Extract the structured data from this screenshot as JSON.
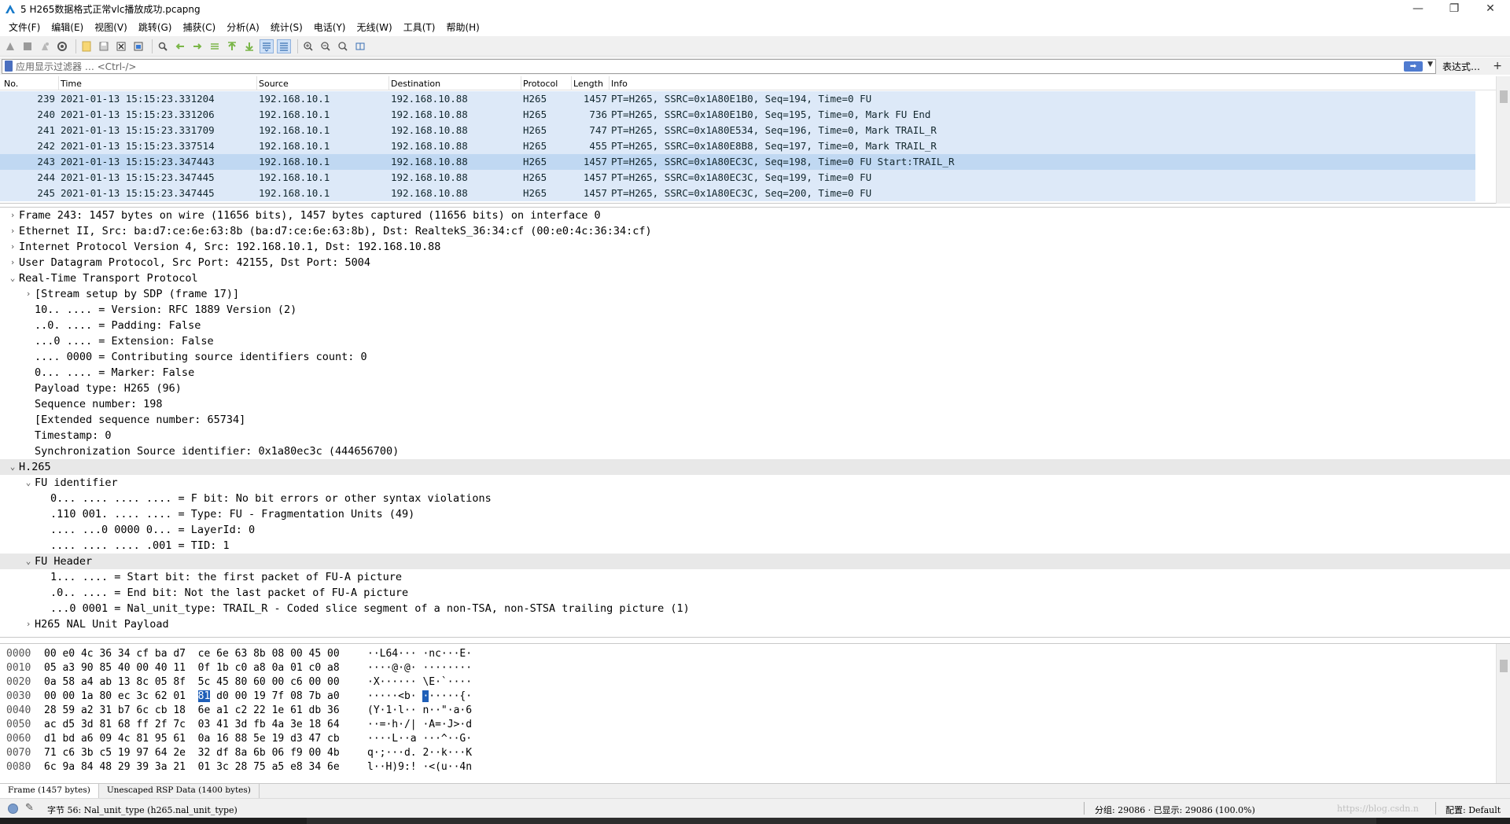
{
  "window": {
    "title": "5 H265数据格式正常vlc播放成功.pcapng",
    "minimize_glyph": "—",
    "maximize_glyph": "❐",
    "close_glyph": "✕"
  },
  "menu": [
    "文件(F)",
    "编辑(E)",
    "视图(V)",
    "跳转(G)",
    "捕获(C)",
    "分析(A)",
    "统计(S)",
    "电话(Y)",
    "无线(W)",
    "工具(T)",
    "帮助(H)"
  ],
  "filter": {
    "placeholder": "应用显示过滤器 … <Ctrl-/>",
    "apply_glyph": "➡",
    "dropdown_glyph": "▼",
    "expression_label": "表达式…",
    "add_glyph": "+"
  },
  "packet_list": {
    "columns": [
      "No.",
      "Time",
      "Source",
      "Destination",
      "Protocol",
      "Length",
      "Info"
    ],
    "rows": [
      {
        "no": "239",
        "time": "2021-01-13 15:15:23.331204",
        "src": "192.168.10.1",
        "dst": "192.168.10.88",
        "proto": "H265",
        "len": "1457",
        "info": "PT=H265, SSRC=0x1A80E1B0, Seq=194, Time=0 FU"
      },
      {
        "no": "240",
        "time": "2021-01-13 15:15:23.331206",
        "src": "192.168.10.1",
        "dst": "192.168.10.88",
        "proto": "H265",
        "len": "736",
        "info": "PT=H265, SSRC=0x1A80E1B0, Seq=195, Time=0, Mark FU End"
      },
      {
        "no": "241",
        "time": "2021-01-13 15:15:23.331709",
        "src": "192.168.10.1",
        "dst": "192.168.10.88",
        "proto": "H265",
        "len": "747",
        "info": "PT=H265, SSRC=0x1A80E534, Seq=196, Time=0, Mark TRAIL_R"
      },
      {
        "no": "242",
        "time": "2021-01-13 15:15:23.337514",
        "src": "192.168.10.1",
        "dst": "192.168.10.88",
        "proto": "H265",
        "len": "455",
        "info": "PT=H265, SSRC=0x1A80E8B8, Seq=197, Time=0, Mark TRAIL_R"
      },
      {
        "no": "243",
        "time": "2021-01-13 15:15:23.347443",
        "src": "192.168.10.1",
        "dst": "192.168.10.88",
        "proto": "H265",
        "len": "1457",
        "info": "PT=H265, SSRC=0x1A80EC3C, Seq=198, Time=0 FU Start:TRAIL_R",
        "selected": true
      },
      {
        "no": "244",
        "time": "2021-01-13 15:15:23.347445",
        "src": "192.168.10.1",
        "dst": "192.168.10.88",
        "proto": "H265",
        "len": "1457",
        "info": "PT=H265, SSRC=0x1A80EC3C, Seq=199, Time=0 FU"
      },
      {
        "no": "245",
        "time": "2021-01-13 15:15:23.347445",
        "src": "192.168.10.1",
        "dst": "192.168.10.88",
        "proto": "H265",
        "len": "1457",
        "info": "PT=H265, SSRC=0x1A80EC3C, Seq=200, Time=0 FU"
      }
    ]
  },
  "details": [
    {
      "arrow": "›",
      "text": "Frame 243: 1457 bytes on wire (11656 bits), 1457 bytes captured (11656 bits) on interface 0"
    },
    {
      "arrow": "›",
      "text": "Ethernet II, Src: ba:d7:ce:6e:63:8b (ba:d7:ce:6e:63:8b), Dst: RealtekS_36:34:cf (00:e0:4c:36:34:cf)"
    },
    {
      "arrow": "›",
      "text": "Internet Protocol Version 4, Src: 192.168.10.1, Dst: 192.168.10.88"
    },
    {
      "arrow": "›",
      "text": "User Datagram Protocol, Src Port: 42155, Dst Port: 5004"
    },
    {
      "arrow": "⌄",
      "text": "Real-Time Transport Protocol"
    },
    {
      "arrow": "›",
      "text": "[Stream setup by SDP (frame 17)]"
    },
    {
      "arrow": "",
      "text": "10.. .... = Version: RFC 1889 Version (2)"
    },
    {
      "arrow": "",
      "text": "..0. .... = Padding: False"
    },
    {
      "arrow": "",
      "text": "...0 .... = Extension: False"
    },
    {
      "arrow": "",
      "text": ".... 0000 = Contributing source identifiers count: 0"
    },
    {
      "arrow": "",
      "text": "0... .... = Marker: False"
    },
    {
      "arrow": "",
      "text": "Payload type: H265 (96)"
    },
    {
      "arrow": "",
      "text": "Sequence number: 198"
    },
    {
      "arrow": "",
      "text": "[Extended sequence number: 65734]"
    },
    {
      "arrow": "",
      "text": "Timestamp: 0"
    },
    {
      "arrow": "",
      "text": "Synchronization Source identifier: 0x1a80ec3c (444656700)"
    },
    {
      "arrow": "⌄",
      "text": "H.265"
    },
    {
      "arrow": "⌄",
      "text": "FU identifier"
    },
    {
      "arrow": "",
      "text": "0... .... .... .... = F bit: No bit errors or other syntax violations"
    },
    {
      "arrow": "",
      "text": ".110 001. .... .... = Type: FU - Fragmentation Units (49)"
    },
    {
      "arrow": "",
      "text": ".... ...0 0000 0... = LayerId: 0"
    },
    {
      "arrow": "",
      "text": ".... .... .... .001 = TID: 1"
    },
    {
      "arrow": "⌄",
      "text": "FU Header"
    },
    {
      "arrow": "",
      "text": "1... .... = Start bit: the first packet of FU-A picture"
    },
    {
      "arrow": "",
      "text": ".0.. .... = End bit: Not the last packet of FU-A picture"
    },
    {
      "arrow": "",
      "text": "...0 0001 = Nal_unit_type: TRAIL_R - Coded slice segment of a non-TSA, non-STSA trailing picture (1)"
    },
    {
      "arrow": "›",
      "text": "H265 NAL Unit Payload"
    }
  ],
  "bytes": [
    {
      "off": "0000",
      "hex": "00 e0 4c 36 34 cf ba d7  ce 6e 63 8b 08 00 45 00",
      "asc": "··L64··· ·nc···E·"
    },
    {
      "off": "0010",
      "hex": "05 a3 90 85 40 00 40 11  0f 1b c0 a8 0a 01 c0 a8",
      "asc": "····@·@· ········"
    },
    {
      "off": "0020",
      "hex": "0a 58 a4 ab 13 8c 05 8f  5c 45 80 60 00 c6 00 00",
      "asc": "·X······ \\E·`····"
    },
    {
      "off": "0030",
      "hex_a": "00 00 1a 80 ec 3c 62 01  ",
      "hex_sel": "81",
      "hex_b": " d0 00 19 7f 08 7b a0",
      "asc_a": "·····<b· ",
      "asc_sel": "·",
      "asc_b": "·····{·"
    },
    {
      "off": "0040",
      "hex": "28 59 a2 31 b7 6c cb 18  6e a1 c2 22 1e 61 db 36",
      "asc": "(Y·1·l·· n··\"·a·6"
    },
    {
      "off": "0050",
      "hex": "ac d5 3d 81 68 ff 2f 7c  03 41 3d fb 4a 3e 18 64",
      "asc": "··=·h·/| ·A=·J>·d"
    },
    {
      "off": "0060",
      "hex": "d1 bd a6 09 4c 81 95 61  0a 16 88 5e 19 d3 47 cb",
      "asc": "····L··a ···^··G·"
    },
    {
      "off": "0070",
      "hex": "71 c6 3b c5 19 97 64 2e  32 df 8a 6b 06 f9 00 4b",
      "asc": "q·;···d. 2··k···K"
    },
    {
      "off": "0080",
      "hex": "6c 9a 84 48 29 39 3a 21  01 3c 28 75 a5 e8 34 6e",
      "asc": "l··H)9:! ·<(u··4n"
    }
  ],
  "byte_tabs": [
    "Frame (1457 bytes)",
    "Unescaped RSP Data (1400 bytes)"
  ],
  "status": {
    "field": "字节 56: Nal_unit_type (h265.nal_unit_type)",
    "packets": "分组: 29086 · 已显示: 29086 (100.0%)",
    "watermark": "https://blog.csdn.n",
    "profile": "配置: Default"
  },
  "colors": {
    "row_bg": "#dde9f8",
    "row_selected_bg": "#c0d8f2",
    "selected_byte_bg": "#1f5fb8"
  }
}
